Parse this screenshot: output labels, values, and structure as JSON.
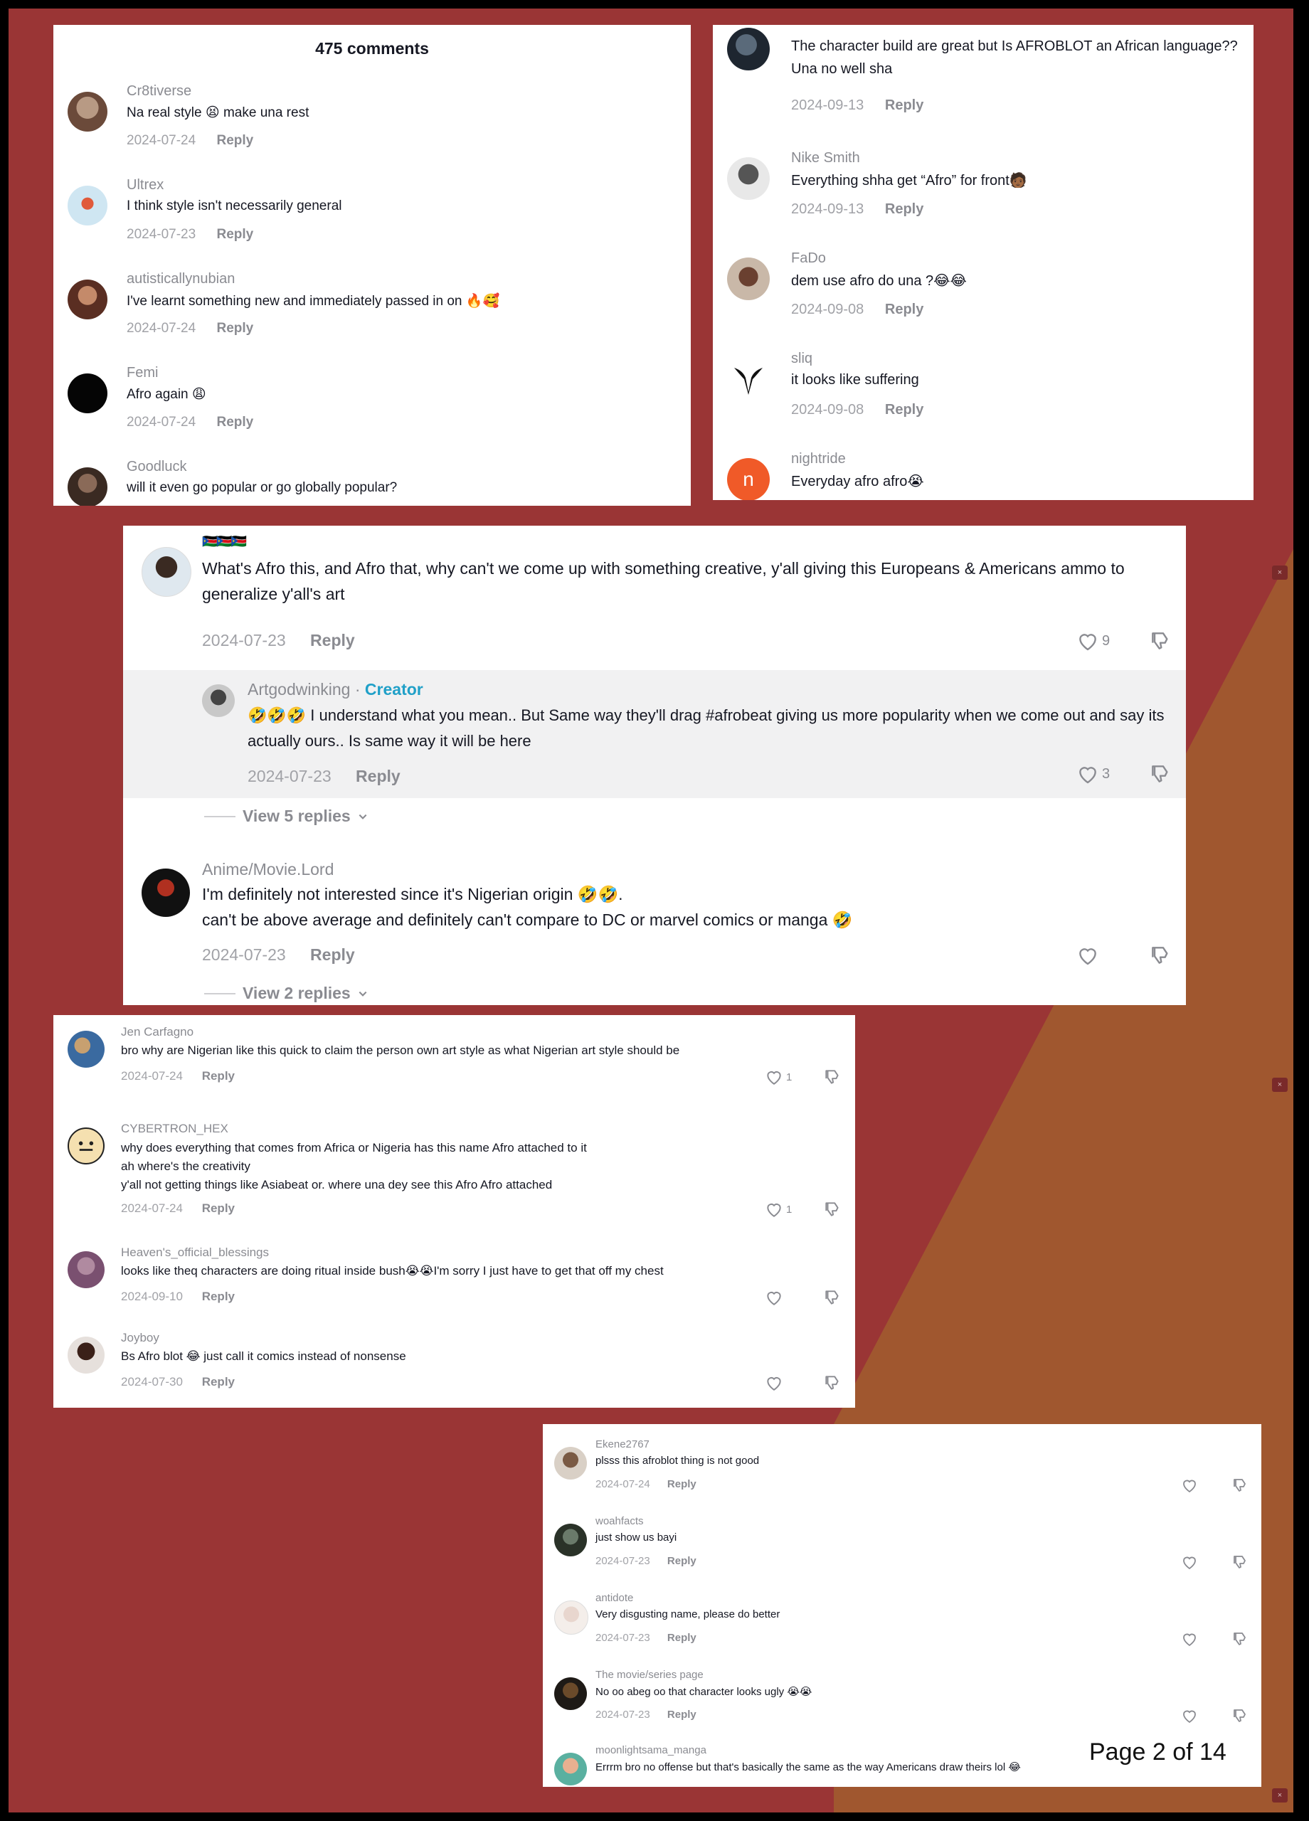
{
  "colors": {
    "background": "#9a3535",
    "accent_triangle": "#a0572f",
    "card": "#ffffff",
    "creator": "#20a0c8",
    "muted": "#8a8b91"
  },
  "top_left": {
    "title": "475 comments",
    "comments": [
      {
        "user": "Cr8tiverse",
        "text": "Na real style 😫 make una rest",
        "date": "2024-07-24",
        "reply": "Reply"
      },
      {
        "user": "Ultrex",
        "text": "I think style isn't necessarily general",
        "date": "2024-07-23",
        "reply": "Reply"
      },
      {
        "user": "autisticallynubian",
        "text": "I've learnt something new and immediately passed in on 🔥🥰",
        "date": "2024-07-24",
        "reply": "Reply"
      },
      {
        "user": "Femi",
        "text": "Afro again 😩",
        "date": "2024-07-24",
        "reply": "Reply"
      },
      {
        "user": "Goodluck",
        "text": "will it even go popular or go globally popular?"
      }
    ]
  },
  "top_right": {
    "comments": [
      {
        "user": "",
        "text": "The character build are great but Is AFROBLOT an African language??\nUna no well sha",
        "date": "2024-09-13",
        "reply": "Reply"
      },
      {
        "user": "Nike Smith",
        "text": "Everything shha get “Afro” for front🧑🏾",
        "date": "2024-09-13",
        "reply": "Reply"
      },
      {
        "user": "FaDo",
        "text": "dem use afro do una ?😂😂",
        "date": "2024-09-08",
        "reply": "Reply"
      },
      {
        "user": "sliq",
        "text": "it looks like suffering",
        "date": "2024-09-08",
        "reply": "Reply"
      },
      {
        "user": "nightride",
        "text": "Everyday afro afro😭",
        "avatar_letter": "n"
      }
    ]
  },
  "middle": {
    "c1": {
      "user_flags": "🇸🇸🇸🇸🇸🇸",
      "text": "What's Afro this, and Afro that, why can't we come up with something creative, y'all giving this Europeans & Americans ammo to generalize y'all's art",
      "date": "2024-07-23",
      "reply": "Reply",
      "likes": "9"
    },
    "c1_reply": {
      "user": "Artgodwinking",
      "separator": " · ",
      "badge": "Creator",
      "text": "🤣🤣🤣 I understand what you mean.. But Same way they'll drag #afrobeat giving us more popularity when we come out and say its actually ours.. Is same way it will be here",
      "date": "2024-07-23",
      "reply": "Reply",
      "likes": "3"
    },
    "view1": "View 5 replies",
    "c2": {
      "user": "Anime/Movie.Lord",
      "text": "I'm definitely not interested since it's Nigerian origin 🤣🤣.\ncan't be above average and definitely can't compare to DC or marvel comics or manga 🤣",
      "date": "2024-07-23",
      "reply": "Reply"
    },
    "view2": "View 2 replies"
  },
  "lower_left": {
    "comments": [
      {
        "user": "Jen Carfagno",
        "text": "bro why are Nigerian like this quick to claim the person own art style as what Nigerian art style should be",
        "date": "2024-07-24",
        "reply": "Reply",
        "likes": "1"
      },
      {
        "user": "CYBERTRON_HEX",
        "text": "why does everything that comes from Africa or Nigeria has this name Afro attached to it\nah where's the creativity\ny'all not getting things like Asiabeat or. where una dey see this Afro Afro attached",
        "date": "2024-07-24",
        "reply": "Reply",
        "likes": "1"
      },
      {
        "user": "Heaven's_official_blessings",
        "text": "looks like theq characters are doing ritual inside bush😭😭I'm sorry I just have to get that off my chest",
        "date": "2024-09-10",
        "reply": "Reply",
        "likes": ""
      },
      {
        "user": "Joyboy",
        "text": "Bs Afro blot 😂 just call it comics instead of nonsense",
        "date": "2024-07-30",
        "reply": "Reply",
        "likes": ""
      }
    ]
  },
  "lower_right": {
    "comments": [
      {
        "user": "Ekene2767",
        "text": "plsss this afroblot thing is not good",
        "date": "2024-07-24",
        "reply": "Reply"
      },
      {
        "user": "woahfacts",
        "text": "just show us bayi",
        "date": "2024-07-23",
        "reply": "Reply"
      },
      {
        "user": "antidote",
        "text": "Very disgusting name, please do better",
        "date": "2024-07-23",
        "reply": "Reply"
      },
      {
        "user": "The movie/series page",
        "text": "No oo abeg oo that character looks ugly 😭😭",
        "date": "2024-07-23",
        "reply": "Reply"
      },
      {
        "user": "moonlightsama_manga",
        "text": "Errrm bro no offense but that's basically the same as the way Americans draw theirs lol 😂"
      }
    ],
    "page_label": "Page 2 of 14"
  }
}
